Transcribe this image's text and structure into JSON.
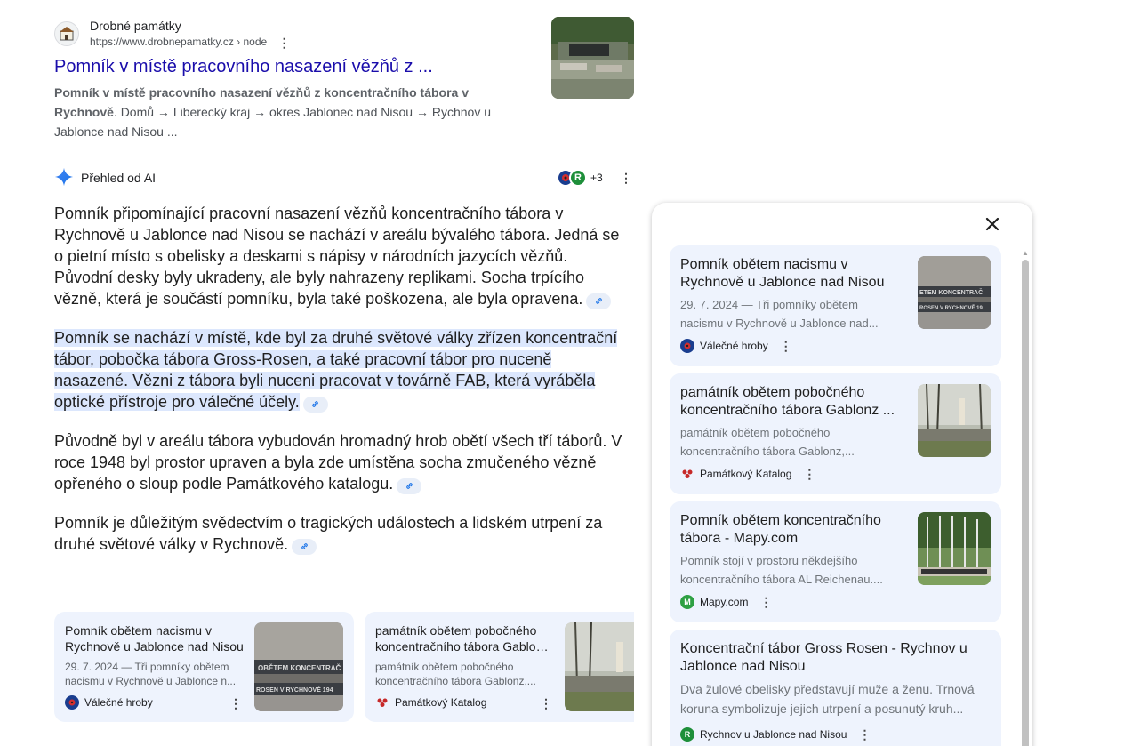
{
  "result": {
    "site_name": "Drobné památky",
    "url": "https://www.drobnepamatky.cz › node",
    "title": "Pomník v místě pracovního nasazení vězňů z ...",
    "snippet_bold": "Pomník v místě pracovního nasazení vězňů z koncentračního tábora v Rychnově",
    "snippet_rest": ". Domů → Liberecký kraj → okres Jablonec nad Nisou → Rychnov u Jablonce nad Nisou ..."
  },
  "ai_overview": {
    "title": "Přehled od AI",
    "extra_sources": "+3",
    "paragraphs": [
      "Pomník připomínající pracovní nasazení vězňů koncentračního tábora v Rychnově u Jablonce nad Nisou  se nachází v areálu bývalého tábora. Jedná se o pietní místo s obelisky a deskami s nápisy v národních jazycích vězňů. Původní desky byly ukradeny, ale byly nahrazeny replikami. Socha trpícího vězně, která je součástí pomníku, byla také poškozena, ale byla opravena.",
      "Pomník se nachází v místě, kde byl za druhé světové války zřízen koncentrační tábor, pobočka tábora Gross-Rosen, a také pracovní tábor pro nuceně nasazené. Vězni z tábora byli nuceni pracovat v továrně FAB, která vyráběla optické přístroje pro válečné účely.",
      "Původně byl v areálu tábora vybudován hromadný hrob obětí všech tří táborů. V roce 1948 byl prostor upraven a byla zde umístěna socha zmučeného vězně opřeného o sloup podle Památkového katalogu.",
      "Pomník je důležitým svědectvím o tragických událostech a lidském utrpení za druhé světové války v Rychnově."
    ]
  },
  "carousel": [
    {
      "title1": "Pomník obětem nacismu v",
      "title2": "Rychnově u Jablonce nad Nisou",
      "snip1": "29. 7. 2024 — Tři pomníky obětem",
      "snip2": "nacismu v Rychnově u Jablonce n...",
      "source": "Válečné hroby"
    },
    {
      "title1": "památník obětem pobočného",
      "title2": "koncentračního tábora Gablonz ...",
      "snip1": "památník obětem pobočného",
      "snip2": "koncentračního tábora Gablonz,...",
      "source": "Památkový Katalog"
    }
  ],
  "panel": {
    "cards": [
      {
        "title1": "Pomník obětem nacismu v",
        "title2": "Rychnově u Jablonce nad Nisou",
        "snip1": "29. 7. 2024 — Tři pomníky obětem",
        "snip2": "nacismu v Rychnově u Jablonce nad...",
        "source": "Válečné hroby"
      },
      {
        "title1": "památník obětem pobočného",
        "title2": "koncentračního tábora Gablonz ...",
        "snip1": "památník obětem pobočného",
        "snip2": "koncentračního tábora Gablonz,...",
        "source": "Památkový Katalog"
      },
      {
        "title1": "Pomník obětem koncentračního",
        "title2": "tábora - Mapy.com",
        "snip1": "Pomník stojí v prostoru někdejšího",
        "snip2": "koncentračního tábora AL Reichenau....",
        "source": "Mapy.com"
      },
      {
        "title1": "Koncentrační tábor Gross Rosen - Rychnov u",
        "title2": "Jablonce nad Nisou",
        "snip1": "Dva žulové obelisky představují muže a ženu. Trnová",
        "snip2": "koruna symbolizuje jejich utrpení a posunutý kruh...",
        "source": "Rychnov u Jablonce nad Nisou"
      }
    ]
  },
  "icons": {
    "site_favicon": "monument-favicon",
    "ai": "gemini-sparkle-icon",
    "link": "link-icon",
    "menu": "more-vert-icon",
    "close": "close-icon"
  },
  "colors": {
    "link_blue": "#1a0dab",
    "highlight": "#dce7fd",
    "card_bg": "#eef3fd",
    "valecne_hroby": "#1a3d8f",
    "pamatkovy_katalog": "#c62828",
    "mapy": "#2ea043",
    "rychnov": "#1e8f3a"
  }
}
